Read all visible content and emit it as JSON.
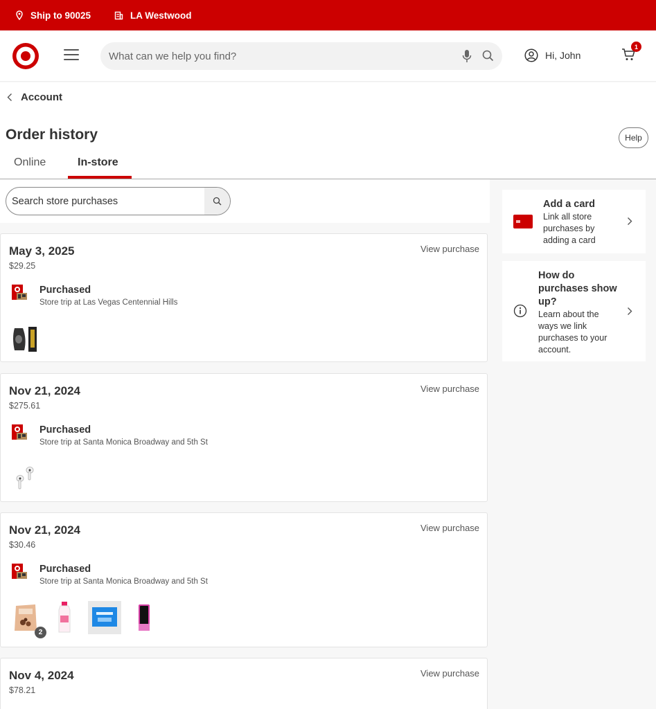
{
  "topbar": {
    "ship_to": "Ship to 90025",
    "store": "LA Westwood"
  },
  "header": {
    "search_placeholder": "What can we help you find?",
    "greeting": "Hi, John",
    "cart_count": "1"
  },
  "nav": {
    "breadcrumb": "Account",
    "page_title": "Order history",
    "help_label": "Help",
    "tabs": [
      {
        "label": "Online",
        "active": false
      },
      {
        "label": "In-store",
        "active": true
      }
    ]
  },
  "store_search": {
    "placeholder": "Search store purchases"
  },
  "orders": [
    {
      "date": "May 3, 2025",
      "total": "$29.25",
      "link": "View purchase",
      "status": "Purchased",
      "store": "Store trip at Las Vegas Centennial Hills"
    },
    {
      "date": "Nov 21, 2024",
      "total": "$275.61",
      "link": "View purchase",
      "status": "Purchased",
      "store": "Store trip at Santa Monica Broadway and 5th St"
    },
    {
      "date": "Nov 21, 2024",
      "total": "$30.46",
      "link": "View purchase",
      "status": "Purchased",
      "store": "Store trip at Santa Monica Broadway and 5th St",
      "qty_badge": "2"
    },
    {
      "date": "Nov 4, 2024",
      "total": "$78.21",
      "link": "View purchase"
    }
  ],
  "sidebar": {
    "add_card": {
      "title": "Add a card",
      "desc": "Link all store purchases by adding a card"
    },
    "how_purchases": {
      "title": "How do purchases show up?",
      "desc": "Learn about the ways we link purchases to your account."
    }
  },
  "colors": {
    "brand_red": "#cc0000",
    "page_bg": "#f7f7f7",
    "text": "#333333"
  }
}
